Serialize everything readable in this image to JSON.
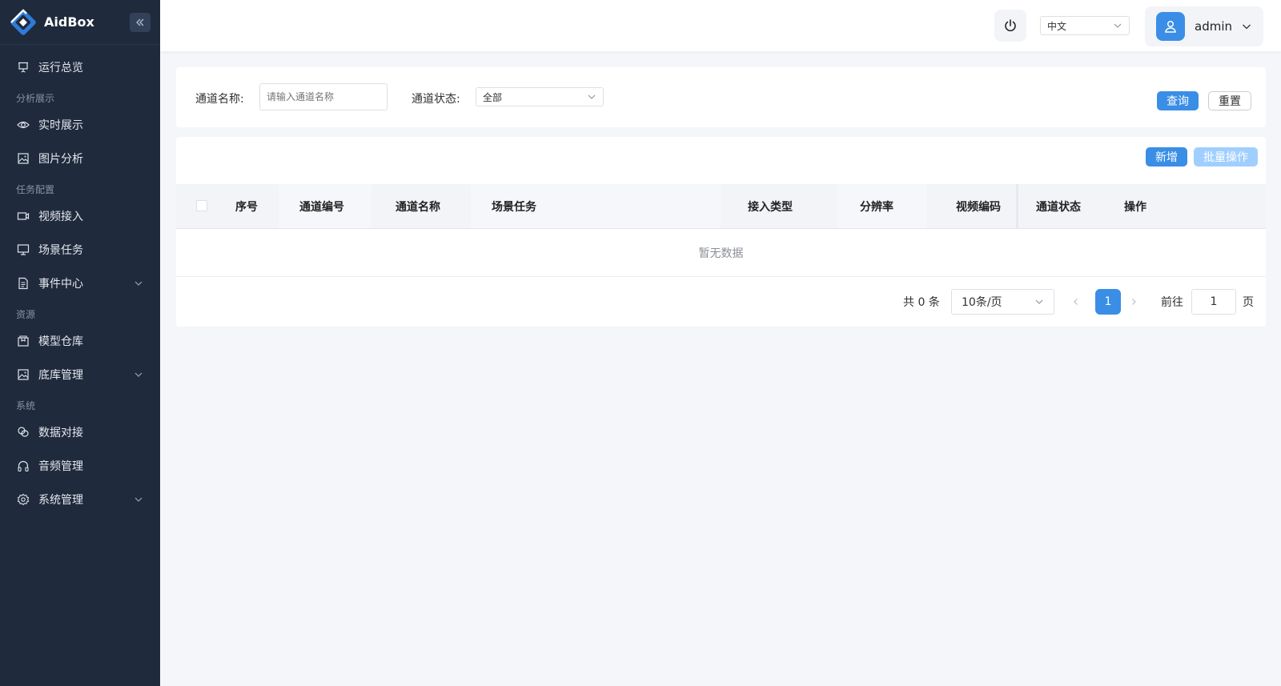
{
  "brand": {
    "name": "AidBox",
    "collapse_icon": "double-chevron-left-icon"
  },
  "colors": {
    "sidebar_bg": "#1f2a3c",
    "primary": "#3a8ee6",
    "primary_light": "#a0cfff",
    "page_bg": "#f4f6fa"
  },
  "sidebar": {
    "overview": "运行总览",
    "groups": [
      {
        "title": "分析展示",
        "items": [
          {
            "label": "实时展示",
            "icon": "eye-icon"
          },
          {
            "label": "图片分析",
            "icon": "image-icon"
          }
        ]
      },
      {
        "title": "任务配置",
        "items": [
          {
            "label": "视频接入",
            "icon": "video-icon"
          },
          {
            "label": "场景任务",
            "icon": "monitor-icon"
          },
          {
            "label": "事件中心",
            "icon": "document-icon"
          }
        ]
      },
      {
        "title": "资源",
        "items": [
          {
            "label": "模型仓库",
            "icon": "package-icon"
          },
          {
            "label": "底库管理",
            "icon": "image-icon"
          }
        ]
      },
      {
        "title": "系统",
        "items": [
          {
            "label": "数据对接",
            "icon": "link-icon"
          },
          {
            "label": "音频管理",
            "icon": "headphones-icon"
          },
          {
            "label": "系统管理",
            "icon": "gear-icon"
          }
        ]
      }
    ]
  },
  "header": {
    "language": "中文",
    "username": "admin"
  },
  "filter": {
    "name_label": "通道名称:",
    "name_placeholder": "请输入通道名称",
    "status_label": "通道状态:",
    "status_value": "全部",
    "query_button": "查询",
    "reset_button": "重置"
  },
  "toolbar": {
    "add_button": "新增",
    "batch_button": "批量操作"
  },
  "table": {
    "columns": [
      "序号",
      "通道编号",
      "通道名称",
      "场景任务",
      "接入类型",
      "分辨率",
      "视频编码",
      "通道状态",
      "操作"
    ],
    "empty_text": "暂无数据"
  },
  "pagination": {
    "total_text": "共 0 条",
    "page_size": "10条/页",
    "current_page": "1",
    "goto_label": "前往",
    "goto_value": "1",
    "page_suffix": "页"
  }
}
